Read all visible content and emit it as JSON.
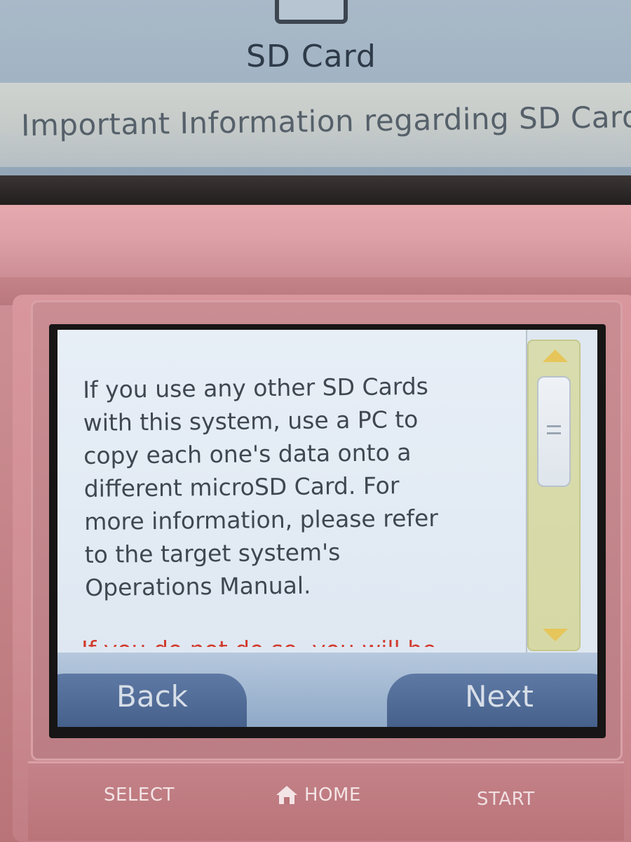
{
  "top_screen": {
    "title": "SD Card",
    "subtitle": "Important Information regarding SD Cards"
  },
  "dialog": {
    "message": "If you use any other SD Cards\nwith this system, use a PC to\ncopy each one's data onto a\ndifferent microSD Card. For\nmore information, please refer\nto the target system's\nOperations Manual.",
    "warning_partial": "If you do not do so, you will be"
  },
  "buttons": {
    "back_label": "Back",
    "next_label": "Next"
  },
  "hardware": {
    "select_label": "SELECT",
    "home_label": "HOME",
    "start_label": "START"
  },
  "icons": {
    "scroll_up": "scroll-up-arrow-icon",
    "scroll_down": "scroll-down-arrow-icon",
    "home": "home-icon"
  },
  "colors": {
    "shell": "#d08f95",
    "screen_bg": "#e3ebf4",
    "button": "#4f6a96",
    "warning": "#d23a2e",
    "scroll_accent": "#e6c55a"
  }
}
